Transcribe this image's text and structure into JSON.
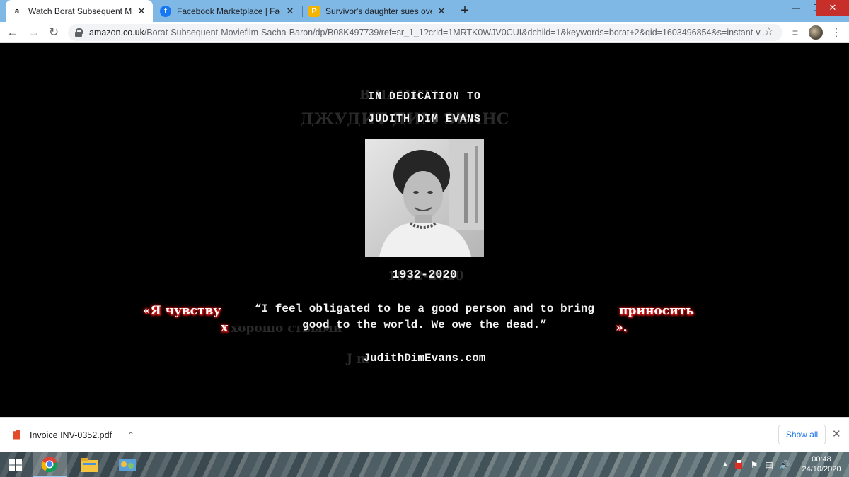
{
  "browser": {
    "tabs": [
      {
        "title": "Watch Borat Subsequent Moviefi",
        "favicon": "amazon-icon",
        "active": true
      },
      {
        "title": "Facebook Marketplace | Faceboo",
        "favicon": "facebook-icon",
        "active": false
      },
      {
        "title": "Survivor's daughter sues over mo",
        "favicon": "news-icon",
        "active": false
      }
    ],
    "new_tab_symbol": "+",
    "url_domain": "amazon.co.uk",
    "url_path": "/Borat-Subsequent-Moviefilm-Sacha-Baron/dp/B08K497739/ref=sr_1_1?crid=1MRTK0WJV0CUI&dchild=1&keywords=borat+2&qid=1603496854&s=instant-v..."
  },
  "video": {
    "heading": "IN DEDICATION TO",
    "name": "JUDITH DIM EVANS",
    "ghost_heading": "В ПАМЯТЬ",
    "ghost_name": "ДЖУДИТ ДИМ ЭВАНС",
    "years": "1932-2020",
    "ghost_years": "1932-2020",
    "quote_line1": "“I feel obligated to be a good person and to bring",
    "quote_line2": "good to the world. We owe the dead.”",
    "ghost_quote_line2": "хорошо                                          ствыми",
    "red_left_line1": "«Я чувству",
    "red_left_line2": "х",
    "red_right_line1": "приносить",
    "red_right_line2": "».",
    "website": "JudithDimEvans.com",
    "ghost_website": "J                                   m"
  },
  "downloads": {
    "file_name": "Invoice INV-0352.pdf",
    "show_all": "Show all"
  },
  "taskbar": {
    "time": "00:48",
    "date": "24/10/2020"
  }
}
